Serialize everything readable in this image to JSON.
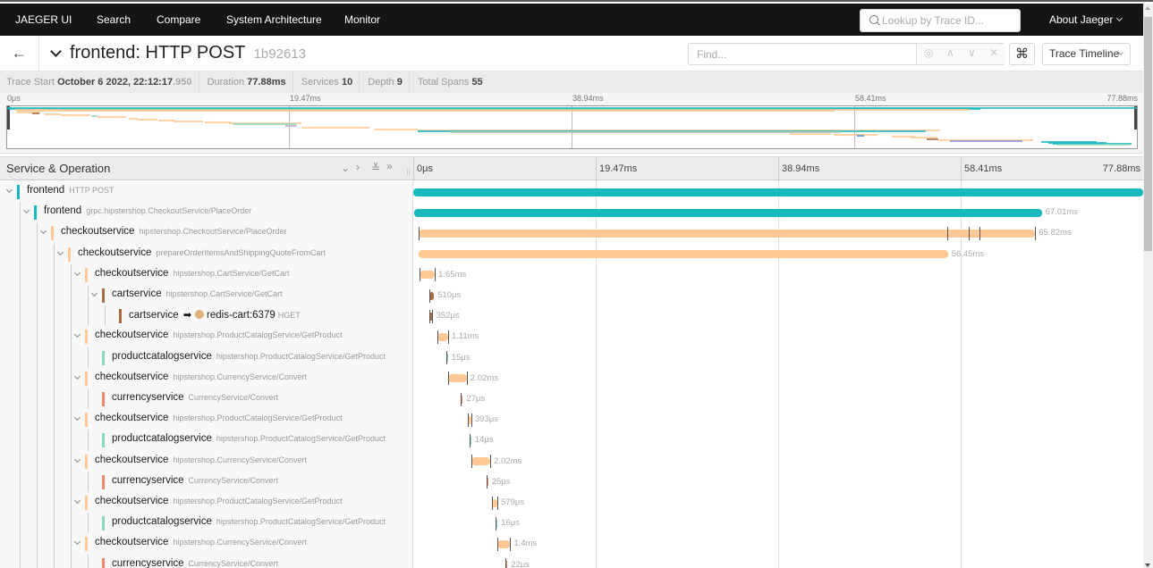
{
  "nav": {
    "brand": "JAEGER UI",
    "items": [
      "Search",
      "Compare",
      "System Architecture",
      "Monitor"
    ],
    "lookup_placeholder": "Lookup by Trace ID...",
    "about": "About Jaeger"
  },
  "header": {
    "back_icon": "←",
    "service": "frontend:",
    "operation": "HTTP POST",
    "trace_id": "1b92613",
    "find_placeholder": "Find...",
    "find_controls": [
      "locate-icon",
      "prev-icon",
      "next-icon",
      "clear-icon"
    ],
    "keyboard_icon": "⌘",
    "view_mode": "Trace Timeline"
  },
  "trace_info": {
    "start_label": "Trace Start",
    "start_value": "October 6 2022, 22:12:17",
    "start_ms": ".950",
    "duration_label": "Duration",
    "duration_value": "77.88ms",
    "services_label": "Services",
    "services_value": "10",
    "depth_label": "Depth",
    "depth_value": "9",
    "spans_label": "Total Spans",
    "spans_value": "55"
  },
  "ticks": [
    "0μs",
    "19.47ms",
    "38.94ms",
    "58.41ms",
    "77.88ms"
  ],
  "total_ms": 77.88,
  "table_header": {
    "label": "Service & Operation",
    "controls": [
      "⌄",
      "›",
      "⩔",
      "»"
    ]
  },
  "colors": {
    "frontend": "#17b8be",
    "checkoutservice": "#ffc894",
    "cartservice": "#a86b45",
    "productcatalogservice": "#8ad9bb",
    "currencyservice": "#f5876a",
    "tick": "#555555"
  },
  "spans": [
    {
      "depth": 0,
      "service": "frontend",
      "operation": "HTTP POST",
      "color": "#17b8be",
      "start_ms": 0,
      "duration_ms": 77.88,
      "label": "",
      "toggle": true
    },
    {
      "depth": 1,
      "service": "frontend",
      "operation": "grpc.hipstershop.CheckoutService/PlaceOrder",
      "color": "#17b8be",
      "start_ms": 0.05,
      "duration_ms": 67.01,
      "label": "67.01ms",
      "toggle": true
    },
    {
      "depth": 2,
      "service": "checkoutservice",
      "operation": "hipstershop.CheckoutService/PlaceOrder",
      "color": "#ffc894",
      "start_ms": 0.55,
      "duration_ms": 65.82,
      "label": "65.82ms",
      "toggle": true,
      "ticks_ms": [
        0.55,
        57.0,
        59.3,
        60.4,
        66.37
      ]
    },
    {
      "depth": 3,
      "service": "checkoutservice",
      "operation": "prepareOrderItemsAndShippingQuoteFromCart",
      "color": "#ffc894",
      "start_ms": 0.6,
      "duration_ms": 56.45,
      "label": "56.45ms",
      "toggle": true
    },
    {
      "depth": 4,
      "service": "checkoutservice",
      "operation": "hipstershop.CartService/GetCart",
      "color": "#ffc894",
      "start_ms": 0.65,
      "duration_ms": 1.65,
      "label": "1.65ms",
      "toggle": true,
      "ticks_ms": [
        0.65,
        2.3
      ]
    },
    {
      "depth": 5,
      "service": "cartservice",
      "operation": "hipstershop.CartService/GetCart",
      "color": "#a86b45",
      "start_ms": 1.7,
      "duration_ms": 0.51,
      "label": "510μs",
      "toggle": true,
      "ticks_ms": [
        1.7
      ]
    },
    {
      "depth": 6,
      "service": "cartservice",
      "peer": "redis-cart:6379",
      "operation": "HGET",
      "color": "#a86b45",
      "start_ms": 1.7,
      "duration_ms": 0.352,
      "label": "352μs",
      "toggle": false,
      "ticks_ms": [
        1.7,
        2.05
      ]
    },
    {
      "depth": 4,
      "service": "checkoutservice",
      "operation": "hipstershop.ProductCatalogService/GetProduct",
      "color": "#ffc894",
      "start_ms": 2.6,
      "duration_ms": 1.11,
      "label": "1.11ms",
      "toggle": true,
      "ticks_ms": [
        2.6,
        3.71
      ]
    },
    {
      "depth": 5,
      "service": "productcatalogservice",
      "operation": "hipstershop.ProductCatalogService/GetProduct",
      "color": "#8ad9bb",
      "start_ms": 3.5,
      "duration_ms": 0.015,
      "label": "15μs",
      "toggle": false,
      "ticks_ms": [
        3.5
      ]
    },
    {
      "depth": 4,
      "service": "checkoutservice",
      "operation": "hipstershop.CurrencyService/Convert",
      "color": "#ffc894",
      "start_ms": 3.7,
      "duration_ms": 2.02,
      "label": "2.02ms",
      "toggle": true,
      "ticks_ms": [
        3.7,
        5.72
      ]
    },
    {
      "depth": 5,
      "service": "currencyservice",
      "operation": "CurrencyService/Convert",
      "color": "#f5876a",
      "start_ms": 5.1,
      "duration_ms": 0.027,
      "label": "27μs",
      "toggle": false,
      "ticks_ms": [
        5.1
      ]
    },
    {
      "depth": 4,
      "service": "checkoutservice",
      "operation": "hipstershop.ProductCatalogService/GetProduct",
      "color": "#ffc894",
      "start_ms": 5.8,
      "duration_ms": 0.393,
      "label": "393μs",
      "toggle": true,
      "ticks_ms": [
        5.8,
        6.19
      ]
    },
    {
      "depth": 5,
      "service": "productcatalogservice",
      "operation": "hipstershop.ProductCatalogService/GetProduct",
      "color": "#8ad9bb",
      "start_ms": 6.0,
      "duration_ms": 0.014,
      "label": "14μs",
      "toggle": false,
      "ticks_ms": [
        6.0
      ]
    },
    {
      "depth": 4,
      "service": "checkoutservice",
      "operation": "hipstershop.CurrencyService/Convert",
      "color": "#ffc894",
      "start_ms": 6.2,
      "duration_ms": 2.02,
      "label": "2.02ms",
      "toggle": true,
      "ticks_ms": [
        6.2,
        8.22
      ]
    },
    {
      "depth": 5,
      "service": "currencyservice",
      "operation": "CurrencyService/Convert",
      "color": "#f5876a",
      "start_ms": 7.8,
      "duration_ms": 0.025,
      "label": "25μs",
      "toggle": false,
      "ticks_ms": [
        7.8
      ]
    },
    {
      "depth": 4,
      "service": "checkoutservice",
      "operation": "hipstershop.ProductCatalogService/GetProduct",
      "color": "#ffc894",
      "start_ms": 8.4,
      "duration_ms": 0.579,
      "label": "579μs",
      "toggle": true,
      "ticks_ms": [
        8.4,
        8.98
      ]
    },
    {
      "depth": 5,
      "service": "productcatalogservice",
      "operation": "hipstershop.ProductCatalogService/GetProduct",
      "color": "#8ad9bb",
      "start_ms": 8.8,
      "duration_ms": 0.016,
      "label": "16μs",
      "toggle": false,
      "ticks_ms": [
        8.8
      ]
    },
    {
      "depth": 4,
      "service": "checkoutservice",
      "operation": "hipstershop.CurrencyService/Convert",
      "color": "#ffc894",
      "start_ms": 8.95,
      "duration_ms": 1.4,
      "label": "1.4ms",
      "toggle": true,
      "ticks_ms": [
        8.95,
        10.35
      ]
    },
    {
      "depth": 5,
      "service": "currencyservice",
      "operation": "CurrencyService/Convert",
      "color": "#f5876a",
      "start_ms": 9.85,
      "duration_ms": 0.022,
      "label": "22μs",
      "toggle": false,
      "ticks_ms": [
        9.85
      ]
    }
  ],
  "minimap": [
    {
      "start_ms": 0,
      "dur_ms": 77.88,
      "row": 0,
      "color": "#17b8be"
    },
    {
      "start_ms": 0.05,
      "dur_ms": 67.01,
      "row": 0.5,
      "color": "#17b8be"
    },
    {
      "start_ms": 0.55,
      "dur_ms": 65.82,
      "row": 1,
      "color": "#ffc894"
    },
    {
      "start_ms": 0.6,
      "dur_ms": 56.45,
      "row": 1.5,
      "color": "#ffc894"
    },
    {
      "start_ms": 0.65,
      "dur_ms": 1.65,
      "row": 2,
      "color": "#ffc894"
    },
    {
      "start_ms": 1.7,
      "dur_ms": 0.51,
      "row": 2.5,
      "color": "#a86b45"
    },
    {
      "start_ms": 2.6,
      "dur_ms": 1.11,
      "row": 3,
      "color": "#ffc894"
    },
    {
      "start_ms": 3.7,
      "dur_ms": 2.02,
      "row": 3.5,
      "color": "#ffc894"
    },
    {
      "start_ms": 5.8,
      "dur_ms": 0.4,
      "row": 4,
      "color": "#8ad9bb"
    },
    {
      "start_ms": 6.2,
      "dur_ms": 2.02,
      "row": 4.5,
      "color": "#ffc894"
    },
    {
      "start_ms": 8.4,
      "dur_ms": 0.58,
      "row": 5,
      "color": "#ffc894"
    },
    {
      "start_ms": 8.95,
      "dur_ms": 1.4,
      "row": 5.5,
      "color": "#ffc894"
    },
    {
      "start_ms": 10.4,
      "dur_ms": 1.2,
      "row": 6,
      "color": "#ffc894"
    },
    {
      "start_ms": 11.5,
      "dur_ms": 2.0,
      "row": 6.5,
      "color": "#ffc894"
    },
    {
      "start_ms": 13.6,
      "dur_ms": 1.8,
      "row": 7,
      "color": "#ffc894"
    },
    {
      "start_ms": 15.3,
      "dur_ms": 5.0,
      "row": 7.5,
      "color": "#ffc894"
    },
    {
      "start_ms": 15.6,
      "dur_ms": 4.3,
      "row": 8,
      "color": "#8ad9bb"
    },
    {
      "start_ms": 19.2,
      "dur_ms": 0.8,
      "row": 8.5,
      "color": "#c9a5c5"
    },
    {
      "start_ms": 20.3,
      "dur_ms": 4.7,
      "row": 9.5,
      "color": "#ffc894"
    },
    {
      "start_ms": 25.3,
      "dur_ms": 3.0,
      "row": 10.5,
      "color": "#ffc894"
    },
    {
      "start_ms": 28.3,
      "dur_ms": 36.0,
      "row": 11,
      "color": "#ffc894"
    },
    {
      "start_ms": 28.3,
      "dur_ms": 35.0,
      "row": 11.3,
      "color": "#17b8be"
    },
    {
      "start_ms": 30.5,
      "dur_ms": 27.0,
      "row": 11.7,
      "color": "#b5c9c0"
    },
    {
      "start_ms": 53.9,
      "dur_ms": 2.9,
      "row": 12.5,
      "color": "#ffc894"
    },
    {
      "start_ms": 57.0,
      "dur_ms": 3.0,
      "row": 13,
      "color": "#ffc894"
    },
    {
      "start_ms": 58.6,
      "dur_ms": 0.5,
      "row": 13.3,
      "color": "#4e8fd8"
    },
    {
      "start_ms": 61.0,
      "dur_ms": 1.6,
      "row": 14,
      "color": "#ffc894"
    },
    {
      "start_ms": 62.3,
      "dur_ms": 1.8,
      "row": 14.5,
      "color": "#ffc894"
    },
    {
      "start_ms": 63.4,
      "dur_ms": 0.8,
      "row": 15,
      "color": "#a86b45"
    },
    {
      "start_ms": 64.2,
      "dur_ms": 6.5,
      "row": 15.5,
      "color": "#ffc894"
    },
    {
      "start_ms": 65.0,
      "dur_ms": 5.0,
      "row": 16,
      "color": "#8c95dc"
    },
    {
      "start_ms": 71.3,
      "dur_ms": 3.8,
      "row": 16.5,
      "color": "#17b8be"
    },
    {
      "start_ms": 71.8,
      "dur_ms": 4.0,
      "row": 17,
      "color": "#17b8be"
    },
    {
      "start_ms": 72.1,
      "dur_ms": 5.4,
      "row": 17.5,
      "color": "#17b8be"
    },
    {
      "start_ms": 72.4,
      "dur_ms": 5.0,
      "row": 18,
      "color": "#8ad9bb"
    }
  ]
}
